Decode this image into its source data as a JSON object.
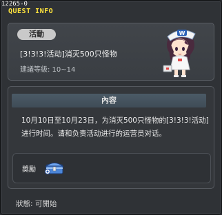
{
  "debug_id": "12265-0",
  "window": {
    "title": "QUEST INFO"
  },
  "quest": {
    "category_badge": "活動",
    "name": "[3!3!3!活动]消灭500只怪物",
    "level_text": "建議等級: 10~14",
    "npc_icon": "npc-nurse-portrait"
  },
  "content": {
    "header": "內容",
    "description": "10月10日至10月23日，为消灭500只怪物的[3!3!3!活动]进行时间。请和负责活动进行的运营员对话。"
  },
  "reward": {
    "label": "獎勵",
    "icon": "treasure-chest-icon"
  },
  "status": {
    "text": "狀態: 可開始"
  },
  "colors": {
    "title": "#ffe43d",
    "window_bg": "#2f3236",
    "header_bar": "#46535e"
  }
}
